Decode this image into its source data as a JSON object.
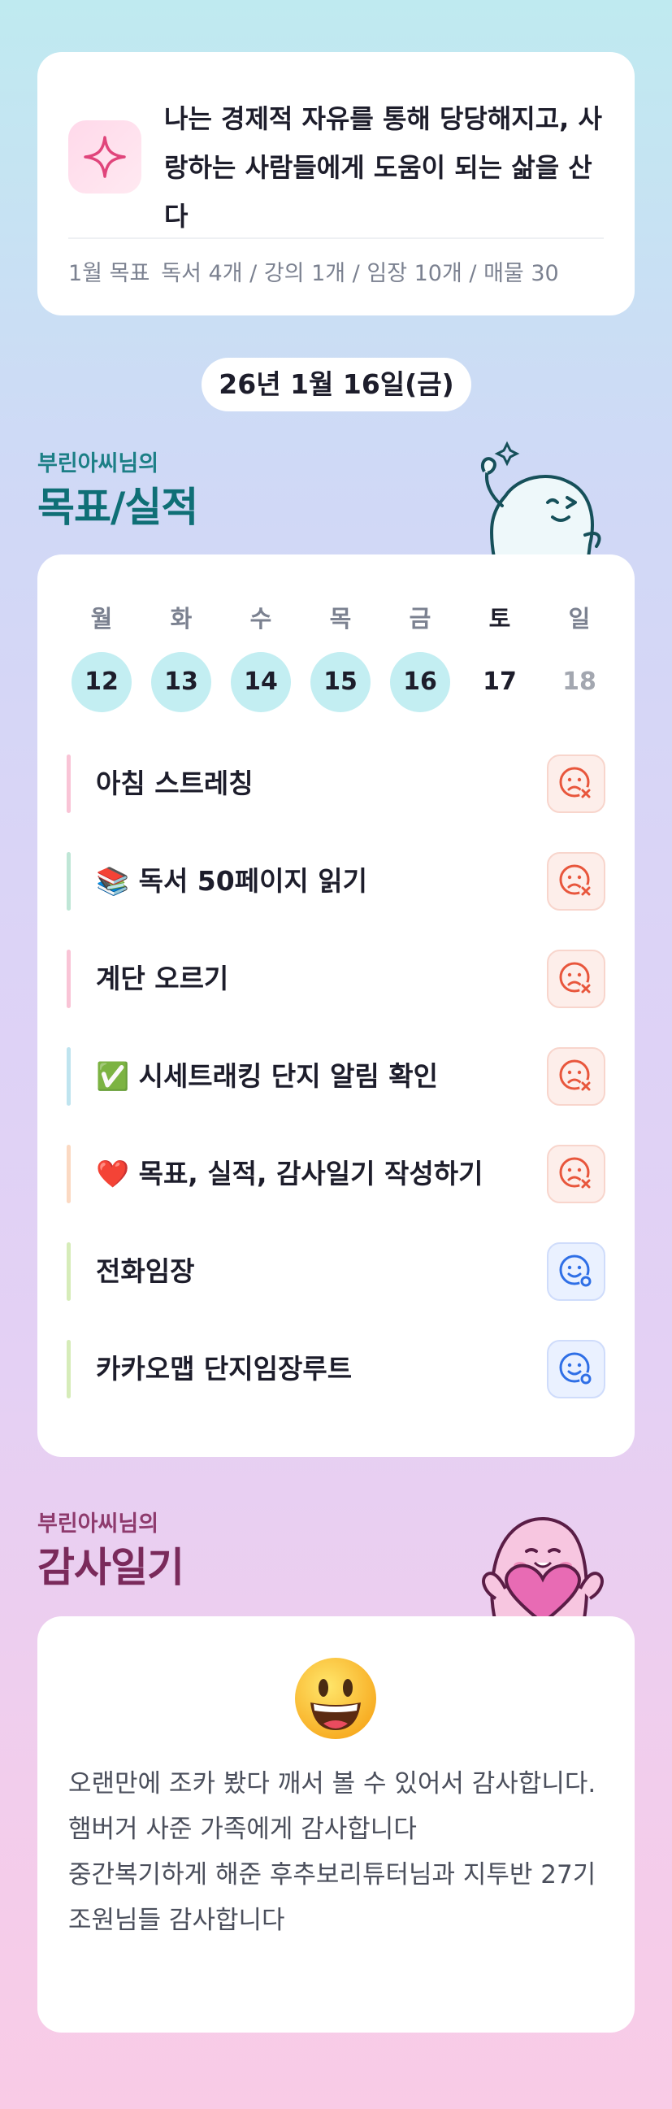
{
  "motto": {
    "text": "나는 경제적 자유를 통해 당당해지고, 사랑하는 사람들에게 도움이 되는 삶을 산다",
    "icon": "sparkle-icon",
    "goal_label": "1월 목표",
    "goal_items": "독서 4개 / 강의 1개 / 임장 10개 / 매물 30"
  },
  "date_pill": "26년 1월 16일(금)",
  "goals_section": {
    "subtitle": "부린아씨님의",
    "title": "목표/실적"
  },
  "calendar": {
    "weekdays": [
      "월",
      "화",
      "수",
      "목",
      "금",
      "토",
      "일"
    ],
    "days": [
      "12",
      "13",
      "14",
      "15",
      "16",
      "17",
      "18"
    ]
  },
  "tasks": [
    {
      "label": "아침 스트레칭",
      "status": "fail",
      "bar_color": "#f9c4d6"
    },
    {
      "label": "📚 독서 50페이지 읽기",
      "status": "fail",
      "bar_color": "#bfe6d6"
    },
    {
      "label": "계단 오르기",
      "status": "fail",
      "bar_color": "#f9c4d6"
    },
    {
      "label": "✅ 시세트래킹 단지 알림 확인",
      "status": "fail",
      "bar_color": "#bfe4ef"
    },
    {
      "label": "❤️ 목표, 실적, 감사일기 작성하기",
      "status": "fail",
      "bar_color": "#fbd9c2"
    },
    {
      "label": "전화임장",
      "status": "ok",
      "bar_color": "#d6ecb9"
    },
    {
      "label": "카카오맵 단지임장루트",
      "status": "ok",
      "bar_color": "#d6ecb9"
    }
  ],
  "thanks_section": {
    "subtitle": "부린아씨님의",
    "title": "감사일기"
  },
  "thanks": {
    "emoji": "grinning-face-icon",
    "lines": [
      "오랜만에 조카 봤다 깨서 볼 수 있어서 감사합니다.",
      "햄버거 사준 가족에게 감사합니다",
      "중간복기하게 해준 후추보리튜터님과 지투반 27기 조원님들 감사합니다"
    ]
  },
  "colors": {
    "teal_title": "#0f6f76",
    "plum_title": "#7a2a5b",
    "done_day": "#c3eef2",
    "fail_face": "#e8563c",
    "ok_face": "#2f6fe6"
  }
}
